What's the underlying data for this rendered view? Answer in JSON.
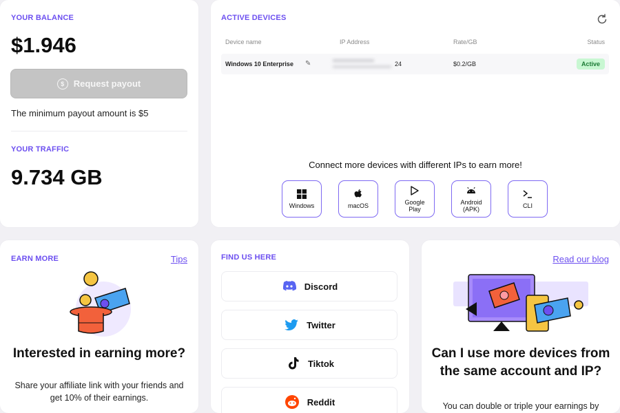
{
  "balance": {
    "title": "YOUR BALANCE",
    "amount": "$1.946",
    "payout_button": "Request payout",
    "payout_icon_glyph": "$",
    "min_note": "The minimum payout amount is $5"
  },
  "traffic": {
    "title": "YOUR TRAFFIC",
    "amount": "9.734 GB"
  },
  "devices": {
    "title": "ACTIVE DEVICES",
    "columns": [
      "Device name",
      "IP Address",
      "Rate/GB",
      "Status"
    ],
    "rows": [
      {
        "name": "Windows 10 Enterprise",
        "ip_suffix": "24",
        "rate": "$0.2/GB",
        "status": "Active"
      }
    ],
    "connect_text": "Connect more devices with different IPs to earn more!",
    "platforms": [
      {
        "label": "Windows",
        "icon": "windows-icon"
      },
      {
        "label": "macOS",
        "icon": "apple-icon"
      },
      {
        "label": "Google Play",
        "icon": "google-play-icon"
      },
      {
        "label": "Android (APK)",
        "icon": "android-icon"
      },
      {
        "label": "CLI",
        "icon": "terminal-icon"
      }
    ]
  },
  "earn": {
    "title": "EARN MORE",
    "tips_link": "Tips",
    "heading": "Interested in earning more?",
    "description": "Share your affiliate link with your friends and get 10% of their earnings."
  },
  "find_us": {
    "title": "FIND US HERE",
    "socials": [
      {
        "label": "Discord",
        "icon": "discord-icon",
        "color": "#5865f2"
      },
      {
        "label": "Twitter",
        "icon": "twitter-icon",
        "color": "#1d9bf0"
      },
      {
        "label": "Tiktok",
        "icon": "tiktok-icon",
        "color": "#111111"
      },
      {
        "label": "Reddit",
        "icon": "reddit-icon",
        "color": "#ff4500"
      }
    ]
  },
  "blog": {
    "link": "Read our blog",
    "heading": "Can I use more devices from the same account and IP?",
    "description": "You can double or triple your earnings by"
  },
  "colors": {
    "accent": "#6c4ff0",
    "active_badge": "#c8f7d2",
    "disabled_button": "#c4c4c4"
  }
}
